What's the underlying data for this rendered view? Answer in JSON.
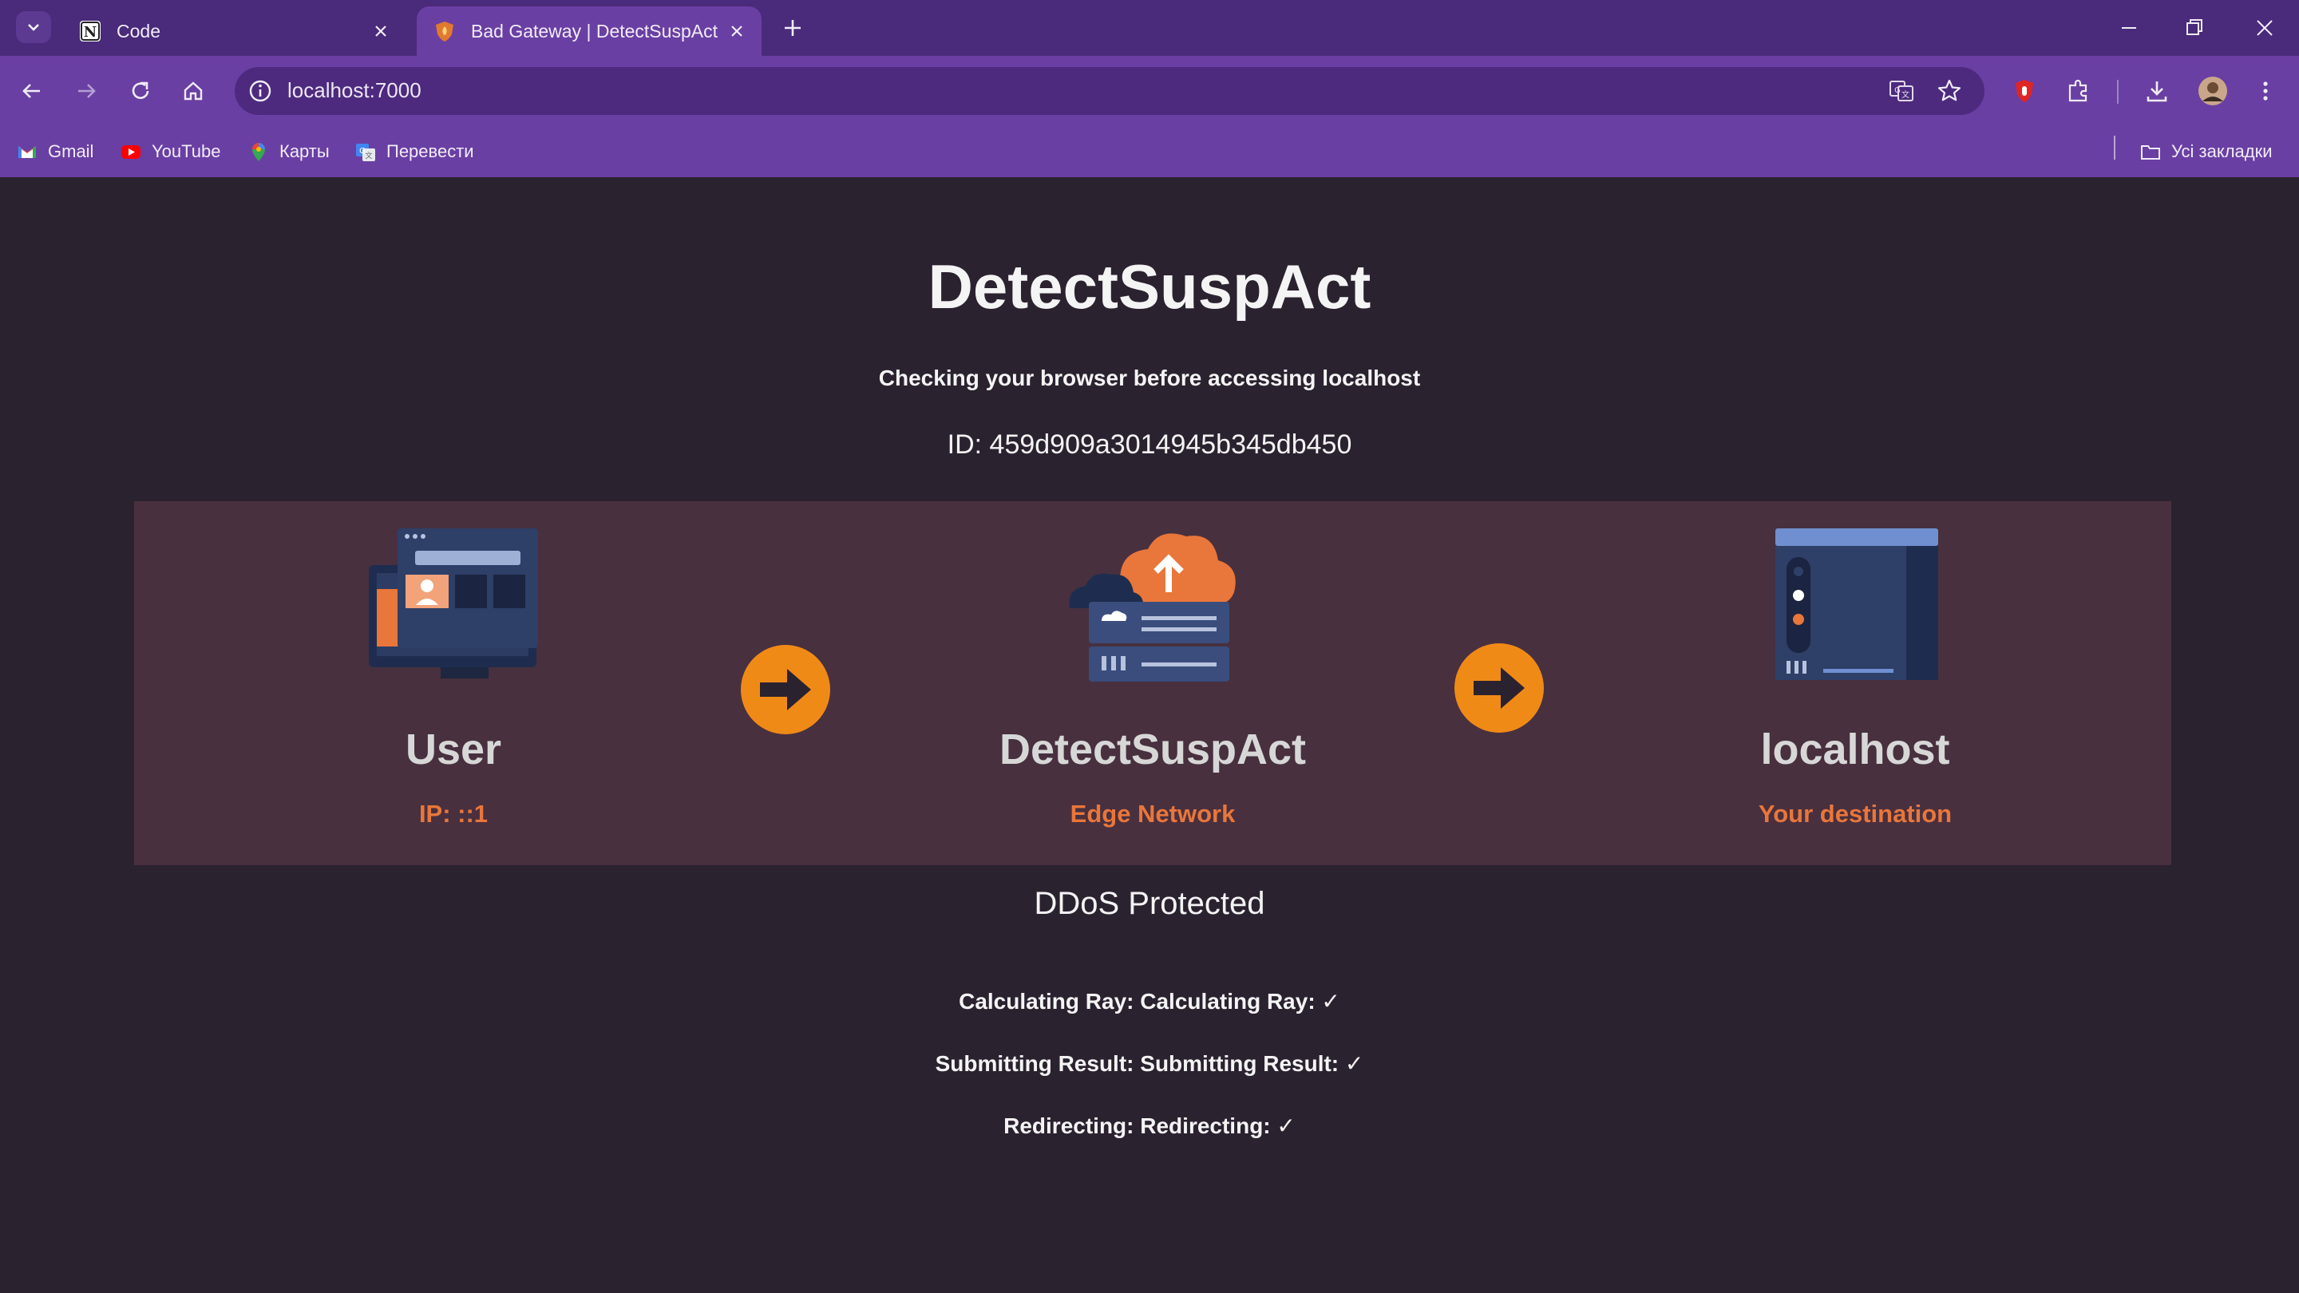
{
  "browser": {
    "tabs": [
      {
        "title": "Code",
        "favicon": "notion-icon",
        "active": false
      },
      {
        "title": "Bad Gateway | DetectSuspAct",
        "favicon": "shield-flame-icon",
        "active": true
      }
    ],
    "address": {
      "url": "localhost:7000"
    },
    "bookmarks": [
      {
        "label": "Gmail",
        "icon": "gmail-icon"
      },
      {
        "label": "YouTube",
        "icon": "youtube-icon"
      },
      {
        "label": "Карты",
        "icon": "maps-icon"
      },
      {
        "label": "Перевести",
        "icon": "translate-icon"
      }
    ],
    "all_bookmarks_label": "Усі закладки",
    "colors": {
      "tabbar": "#4a2a7a",
      "toolbar": "#6a3fa3",
      "omnibox": "#4d2a7e"
    }
  },
  "page": {
    "title": "DetectSuspAct",
    "subtitle_prefix": "Checking your browser before accessing ",
    "subtitle_host": "localhost",
    "request_id": "ID: 459d909a3014945b345db450",
    "nodes": [
      {
        "name": "User",
        "caption": "IP: ::1",
        "icon": "user-computer-icon"
      },
      {
        "name": "DetectSuspAct",
        "caption": "Edge Network",
        "icon": "cloud-server-icon"
      },
      {
        "name": "localhost",
        "caption": "Your destination",
        "icon": "server-icon"
      }
    ],
    "protection_label": "DDoS Protected",
    "steps": [
      {
        "label": "Calculating Ray: ",
        "value": "Calculating Ray: ✓"
      },
      {
        "label": "Submitting Result: ",
        "value": "Submitting Result: ✓"
      },
      {
        "label": "Redirecting: ",
        "value": "Redirecting: ✓"
      }
    ],
    "colors": {
      "background": "#2b2230",
      "panel": "#48303f",
      "accent": "#f08a17",
      "caption": "#e9763a"
    }
  }
}
